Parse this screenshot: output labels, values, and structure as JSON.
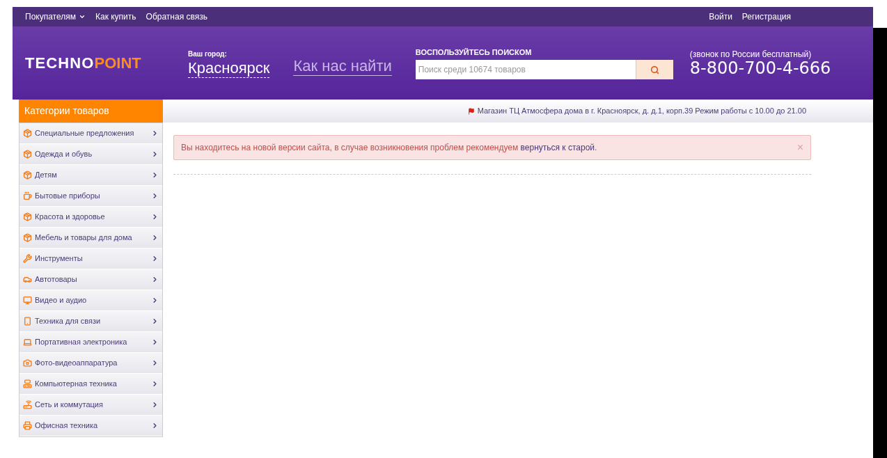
{
  "top_nav": {
    "left": [
      {
        "label": "Покупателям",
        "dropdown": true
      },
      {
        "label": "Как купить",
        "dropdown": false
      },
      {
        "label": "Обратная связь",
        "dropdown": false
      }
    ],
    "right": [
      "Войти",
      "Регистрация"
    ]
  },
  "header": {
    "logo": {
      "left": "TECHNO",
      "right": "POINT"
    },
    "city_label": "Ваш город:",
    "city": "Красноярск",
    "find_us": "Как нас найти",
    "search_title": "ВОСПОЛЬЗУЙТЕСЬ ПОИСКОМ",
    "search": {
      "placeholder": "Поиск среди 10674 товаров"
    },
    "phone_note": "(звонок по России бесплатный)",
    "phone": "8-800-700-4-666"
  },
  "sidebar": {
    "title": "Категории товаров",
    "items": [
      {
        "label": "Специальные предложения"
      },
      {
        "label": "Одежда и обувь"
      },
      {
        "label": "Детям"
      },
      {
        "label": "Бытовые приборы"
      },
      {
        "label": "Красота и здоровье"
      },
      {
        "label": "Мебель и товары для дома"
      },
      {
        "label": "Инструменты"
      },
      {
        "label": "Автотовары"
      },
      {
        "label": "Видео и аудио"
      },
      {
        "label": "Техника для связи"
      },
      {
        "label": "Портативная электроника"
      },
      {
        "label": "Фото-видеоаппаратура"
      },
      {
        "label": "Компьютерная техника"
      },
      {
        "label": "Сеть и коммутация"
      },
      {
        "label": "Офисная техника"
      }
    ]
  },
  "store_info": "Магазин ТЦ Атмосфера дома в г. Красноярск, д. д.1, корп.39 Режим работы с 10.00 до 21.00",
  "alert": {
    "text": "Вы находитесь на новой версии сайта, в случае возникновения проблем рекомендуем",
    "link": "вернуться к старой",
    "end": ".",
    "close": "×"
  }
}
